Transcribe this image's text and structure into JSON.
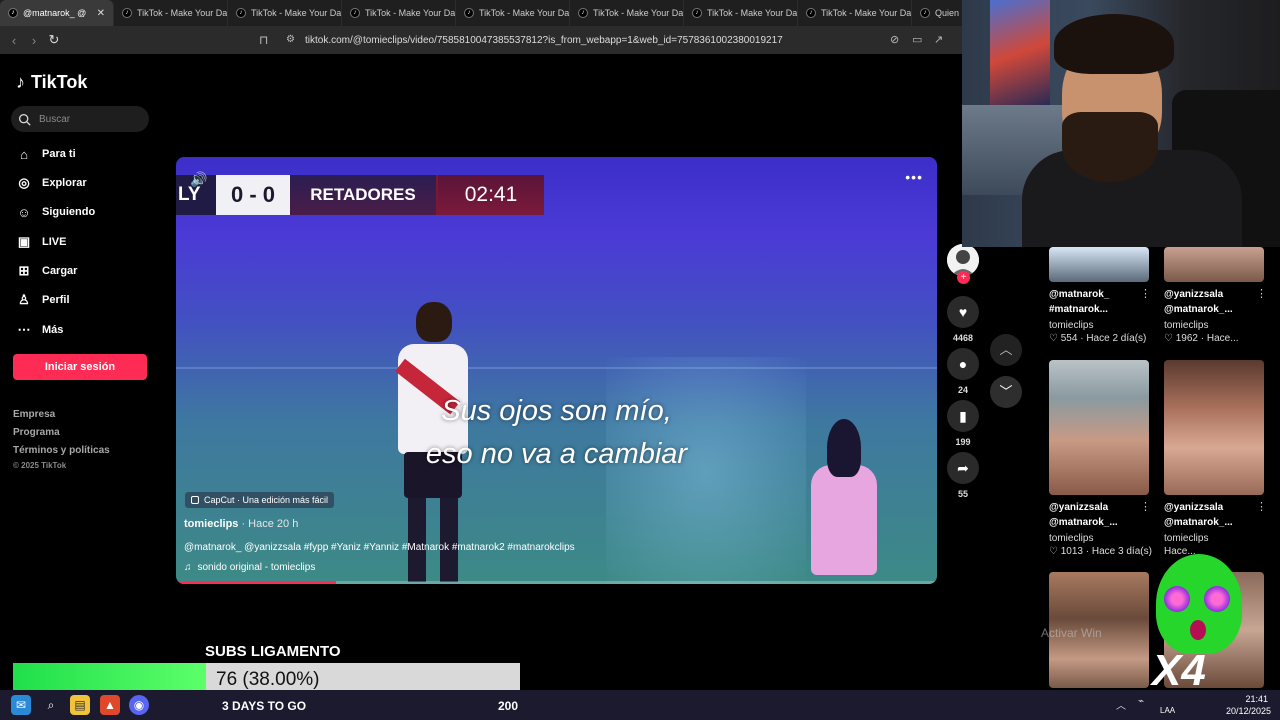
{
  "browser": {
    "tabs": [
      {
        "label": "@matnarok_ @",
        "active": true
      },
      {
        "label": "TikTok - Make Your Da"
      },
      {
        "label": "TikTok - Make Your Da"
      },
      {
        "label": "TikTok - Make Your Da"
      },
      {
        "label": "TikTok - Make Your Da"
      },
      {
        "label": "TikTok - Make Your Da"
      },
      {
        "label": "TikTok - Make Your Da"
      },
      {
        "label": "TikTok - Make Your Da"
      },
      {
        "label": "Quien"
      }
    ],
    "url": "tiktok.com/@tomieclips/video/7585810047385537812?is_from_webapp=1&web_id=7578361002380019217"
  },
  "sidebar": {
    "logo": "TikTok",
    "search_placeholder": "Buscar",
    "items": [
      {
        "label": "Para ti",
        "icon": "home-icon"
      },
      {
        "label": "Explorar",
        "icon": "compass-icon"
      },
      {
        "label": "Siguiendo",
        "icon": "following-icon"
      },
      {
        "label": "LIVE",
        "icon": "live-icon"
      },
      {
        "label": "Cargar",
        "icon": "upload-icon"
      },
      {
        "label": "Perfil",
        "icon": "profile-icon"
      },
      {
        "label": "Más",
        "icon": "more-icon"
      }
    ],
    "login": "Iniciar sesión",
    "footer": [
      "Empresa",
      "Programa",
      "Términos y políticas"
    ],
    "copyright": "© 2025 TikTok"
  },
  "video": {
    "scoreboard": {
      "team": "LY",
      "score": "0 - 0",
      "name": "RETADORES",
      "time": "02:41"
    },
    "subtitle_line1": "Sus ojos son mío,",
    "subtitle_line2": "eso no va a cambiar",
    "capcut": "CapCut · Una edición más fácil",
    "author": "tomieclips",
    "ago": " · Hace 20 h",
    "description": "@matnarok_ @yanizzsala #fypp #Yaniz #Yanniz #Matnarok #matnarok2 #matnarokclips",
    "sound": "sonido original - tomieclips",
    "progress": 0.21
  },
  "actions": {
    "likes": "4468",
    "comments": "24",
    "saves": "199",
    "shares": "55"
  },
  "related": [
    {
      "title1": "@matnarok_",
      "title2": "#matnarok...",
      "user": "tomieclips",
      "likes": "554",
      "ago": "Hace 2 día(s)"
    },
    {
      "title1": "@yanizzsala",
      "title2": "@matnarok_...",
      "user": "tomieclips",
      "likes": "1962",
      "ago": "Hace..."
    },
    {
      "title1": "@yanizzsala",
      "title2": "@matnarok_...",
      "user": "tomieclips",
      "likes": "1013",
      "ago": "Hace 3 día(s)"
    },
    {
      "title1": "@yanizzsala",
      "title2": "@matnarok_...",
      "user": "tomieclips",
      "likes": "",
      "ago": "Hace..."
    }
  ],
  "watermark": "Activar Win",
  "overlay": {
    "subs_title": "SUBS LIGAMENTO",
    "goal_text": "76 (38.00%)",
    "goal_fraction": 0.38,
    "days": "3 DAYS TO GO",
    "target": "200",
    "multiplier": "X4"
  },
  "taskbar": {
    "time": "21:41",
    "date": "20/12/2025",
    "lang": "LAA"
  },
  "colors": {
    "accent": "#fe2c55",
    "goal": "#2ee84a"
  }
}
